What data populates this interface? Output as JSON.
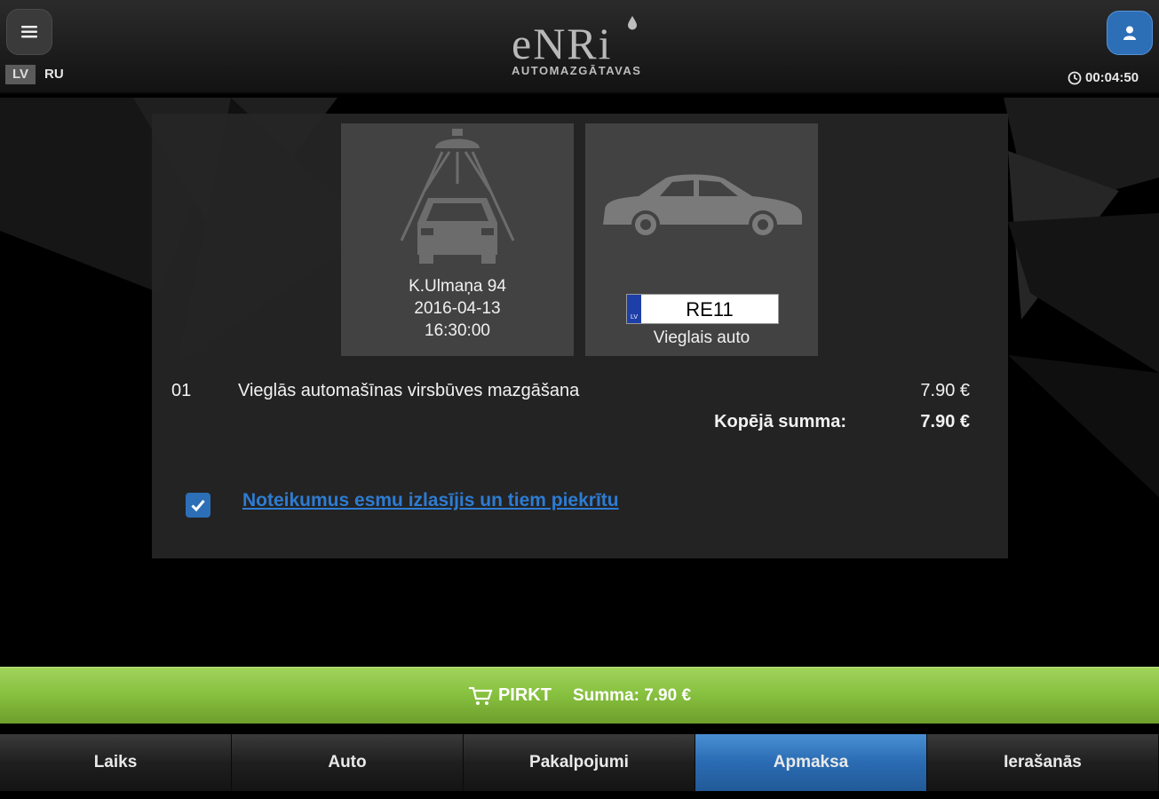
{
  "header": {
    "lang_active": "LV",
    "lang_other": "RU",
    "logo_main": "eNRi",
    "logo_sub": "AUTOMAZGĀTAVAS",
    "timer": "00:04:50"
  },
  "location_card": {
    "icon": "car-wash-icon",
    "address": "K.Ulmaņa 94",
    "date": "2016-04-13",
    "time": "16:30:00"
  },
  "car_card": {
    "icon": "car-icon",
    "plate_country": "LV",
    "plate_number": "RE11",
    "vehicle_type": "Vieglais auto"
  },
  "order": {
    "line_no": "01",
    "line_desc": "Vieglās automašīnas virsbūves mazgāšana",
    "line_price": "7.90 €",
    "total_label": "Kopējā summa:",
    "total_value": "7.90 €"
  },
  "terms": {
    "checked": true,
    "label": "Noteikumus esmu izlasījis un tiem piekrītu"
  },
  "buy": {
    "label": "PIRKT",
    "sum": "Summa: 7.90 €"
  },
  "tabs": [
    {
      "label": "Laiks"
    },
    {
      "label": "Auto"
    },
    {
      "label": "Pakalpojumi"
    },
    {
      "label": "Apmaksa"
    },
    {
      "label": "Ierašanās"
    }
  ],
  "colors": {
    "accent_blue": "#2c6fb6",
    "buy_green": "#86bf3e",
    "panel_bg": "#262626"
  }
}
